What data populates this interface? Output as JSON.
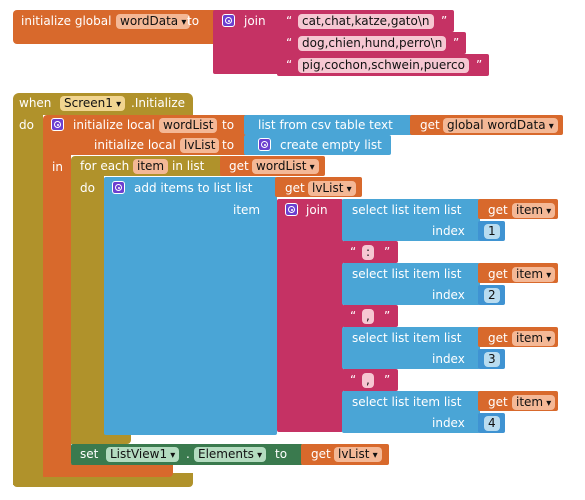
{
  "global_block": {
    "initialize_label": "initialize global",
    "var_name": "wordData",
    "to_label": "to",
    "join_label": "join",
    "strings": [
      "cat,chat,katze,gato\\n",
      "dog,chien,hund,perro\\n",
      "pig,cochon,schwein,puerco"
    ]
  },
  "event_block": {
    "when_label": "when",
    "component": "Screen1",
    "event": ".Initialize",
    "do_label": "do"
  },
  "local1": {
    "initialize_label": "initialize local",
    "var_name": "wordList",
    "to_label": "to",
    "csv_label": "list from csv table  text",
    "get_label": "get",
    "get_var": "global wordData"
  },
  "local2": {
    "initialize_label": "initialize local",
    "var_name": "lvList",
    "to_label": "to",
    "create_label": "create empty list"
  },
  "in_label": "in",
  "foreach": {
    "for_label": "for each",
    "item_var": "item",
    "in_list_label": "in list",
    "get_label": "get",
    "get_var": "wordList",
    "do_label": "do"
  },
  "additems": {
    "label": "add items to list  list",
    "get_label": "get",
    "get_var": "lvList",
    "item_label": "item"
  },
  "join2": {
    "label": "join"
  },
  "select_items": [
    {
      "label": "select list item  list",
      "get_label": "get",
      "get_var": "item",
      "index_label": "index",
      "index": "1"
    },
    {
      "label": "select list item  list",
      "get_label": "get",
      "get_var": "item",
      "index_label": "index",
      "index": "2"
    },
    {
      "label": "select list item  list",
      "get_label": "get",
      "get_var": "item",
      "index_label": "index",
      "index": "3"
    },
    {
      "label": "select list item  list",
      "get_label": "get",
      "get_var": "item",
      "index_label": "index",
      "index": "4"
    }
  ],
  "separators": [
    ":",
    ",",
    ","
  ],
  "setblock": {
    "set_label": "set",
    "component": "ListView1",
    "dot": ".",
    "property": "Elements",
    "to_label": "to",
    "get_label": "get",
    "get_var": "lvList"
  },
  "colors": {
    "variable": "#d8692c",
    "event": "#b0922b",
    "text": "#c53264",
    "list": "#4aa5d6",
    "math": "#3f93d2",
    "component_setter": "#3a7a4e"
  }
}
